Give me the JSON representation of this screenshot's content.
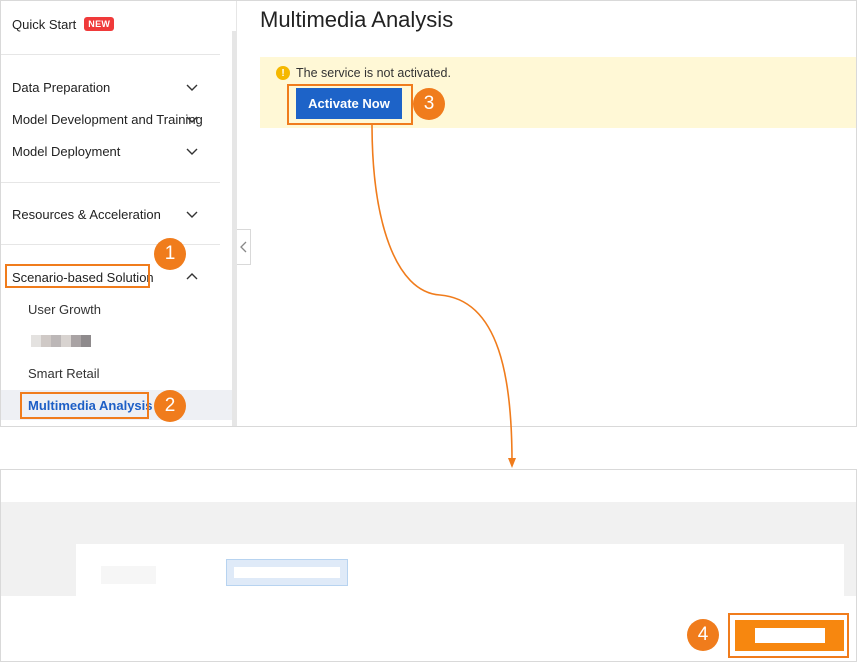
{
  "sidebar": {
    "quick_start": "Quick Start",
    "new_badge": "NEW",
    "items": [
      {
        "label": "Data Preparation"
      },
      {
        "label": "Model Development and Training"
      },
      {
        "label": "Model Deployment"
      },
      {
        "label": "Resources & Acceleration"
      },
      {
        "label": "Scenario-based Solution"
      }
    ],
    "sub_items": [
      {
        "label": "User Growth"
      },
      {
        "label": ""
      },
      {
        "label": "Smart Retail"
      },
      {
        "label": "Multimedia Analysis"
      }
    ]
  },
  "main": {
    "title": "Multimedia Analysis",
    "alert_text": "The service is not activated.",
    "alert_icon": "warning-icon",
    "activate_button": "Activate Now"
  },
  "steps": [
    "1",
    "2",
    "3",
    "4"
  ],
  "colors": {
    "accent_orange": "#f07c1c",
    "primary_blue": "#1d63c8",
    "active_link": "#1d5fc6",
    "badge_red": "#f03a3a",
    "alert_bg": "#fff8d6"
  }
}
